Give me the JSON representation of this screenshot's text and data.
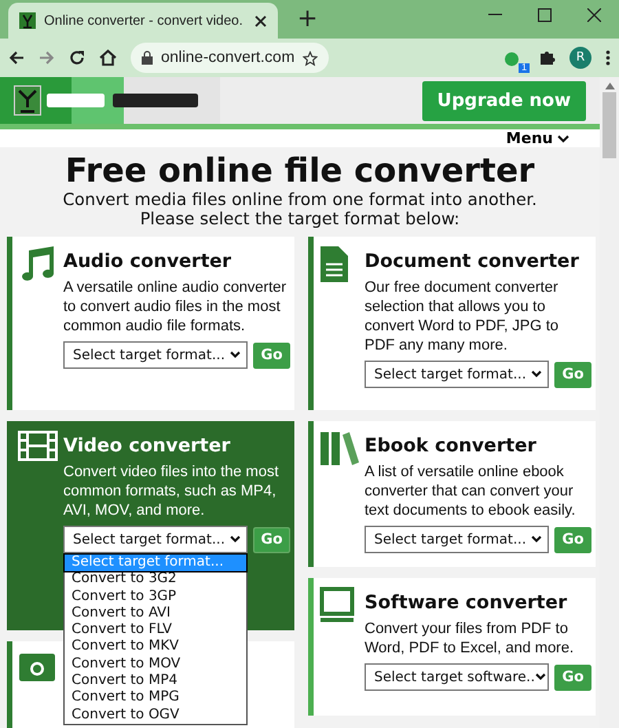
{
  "browser": {
    "tab_title": "Online converter - convert video.",
    "new_tab": "+",
    "url": "online-convert.com",
    "extension_badge": "1",
    "profile_initial": "R"
  },
  "site": {
    "upgrade_button": "Upgrade now",
    "menu": "Menu",
    "title": "Free online file converter",
    "subtitle": [
      "Convert media files online from one format into another.",
      "Please select the target format below:"
    ]
  },
  "columns": [
    {
      "cards": [
        {
          "kind": "audio",
          "highlighted": false,
          "title": "Audio converter",
          "description": "A versatile online audio converter to convert audio files in the most common audio file formats.",
          "select": "Select target format...",
          "go": "Go"
        },
        {
          "kind": "video",
          "highlighted": true,
          "title": "Video converter",
          "description": "Convert video files into the most common formats, such as MP4, AVI, MOV, and more.",
          "select": "Select target format...",
          "go": "Go",
          "open": true
        },
        {
          "kind": "image",
          "highlighted": false
        }
      ]
    },
    {
      "cards": [
        {
          "kind": "document",
          "highlighted": false,
          "title": "Document converter",
          "description": "Our free document converter selection that allows you to convert Word to PDF, JPG to PDF any many more.",
          "select": "Select target format...",
          "go": "Go"
        },
        {
          "kind": "ebook",
          "highlighted": false,
          "title": "Ebook converter",
          "description": "A list of versatile online ebook converter that can convert your text documents to ebook easily.",
          "select": "Select target format...",
          "go": "Go"
        },
        {
          "kind": "software",
          "highlighted": false,
          "title": "Software converter",
          "description": "Convert your files from PDF to Word, PDF to Excel, and more.",
          "select": "Select target software..",
          "go": "Go"
        }
      ]
    }
  ],
  "dropdown_options": [
    {
      "label": "Select target format...",
      "selected": true
    },
    {
      "label": "Convert to 3G2",
      "selected": false
    },
    {
      "label": "Convert to 3GP",
      "selected": false
    },
    {
      "label": "Convert to AVI",
      "selected": false
    },
    {
      "label": "Convert to FLV",
      "selected": false
    },
    {
      "label": "Convert to MKV",
      "selected": false
    },
    {
      "label": "Convert to MOV",
      "selected": false
    },
    {
      "label": "Convert to MP4",
      "selected": false
    },
    {
      "label": "Convert to MPG",
      "selected": false
    },
    {
      "label": "Convert to OGV",
      "selected": false
    }
  ]
}
